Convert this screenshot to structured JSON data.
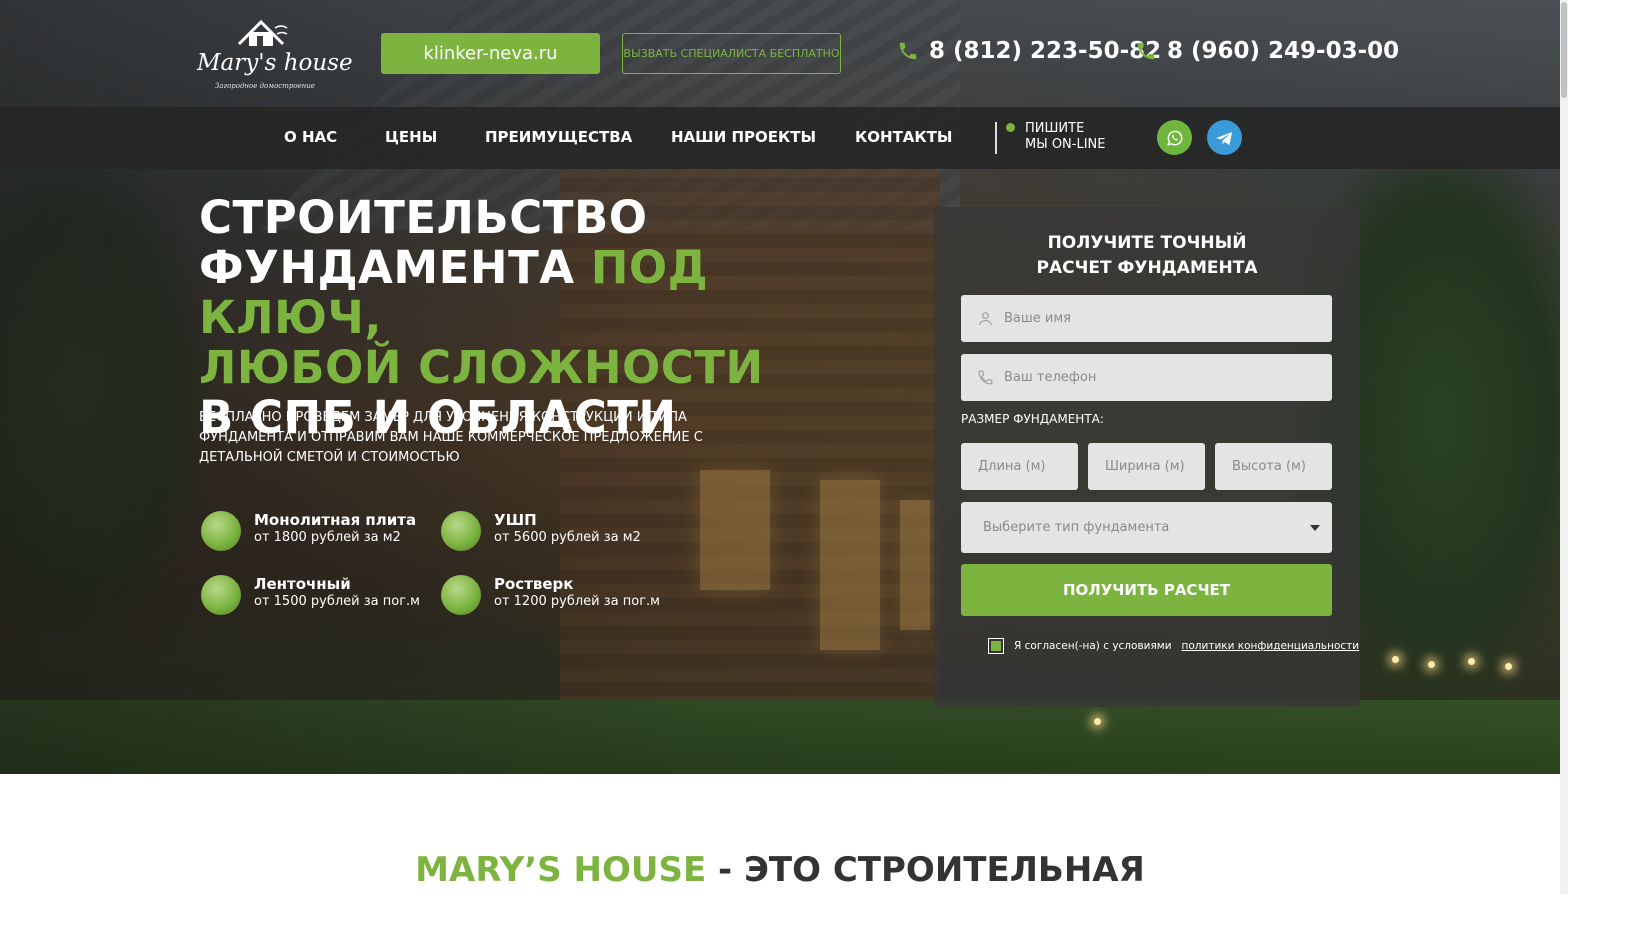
{
  "header": {
    "logo": {
      "name": "Mary's house",
      "tagline": "Загородное домостроение"
    },
    "site_button": "klinker-neva.ru",
    "call_button": "ВЫЗВАТЬ СПЕЦИАЛИСТА БЕСПЛАТНО",
    "phones": [
      "8 (812) 223-50-82",
      "8 (960) 249-03-00"
    ]
  },
  "nav": {
    "items": [
      "О НАС",
      "ЦЕНЫ",
      "ПРЕИМУЩЕСТВА",
      "НАШИ ПРОЕКТЫ",
      "КОНТАКТЫ"
    ],
    "online_line1": "ПИШИТЕ",
    "online_line2": "МЫ ON-LINE",
    "social": [
      "whatsapp-icon",
      "telegram-icon"
    ]
  },
  "hero": {
    "title_white_1": "СТРОИТЕЛЬСТВО",
    "title_white_2": "ФУНДАМЕНТА",
    "title_green_1": "ПОД КЛЮЧ,",
    "title_green_2": "ЛЮБОЙ СЛОЖНОСТИ",
    "title_white_3": "В СПБ И ОБЛАСТИ",
    "subtitle": "БЕСПЛАТНО ПРОВЕДЕМ ЗАМЕР ДЛЯ УТОЧНЕНИЯ КОНСТРУКЦИИ И ТИПА ФУНДАМЕНТА И ОТПРАВИМ ВАМ НАШЕ КОММЕРЧЕСКОЕ ПРЕДЛОЖЕНИЕ С ДЕТАЛЬНОЙ СМЕТОЙ И СТОИМОСТЬЮ",
    "features": [
      {
        "title": "Монолитная плита",
        "desc": "от 1800 рублей за м2"
      },
      {
        "title": "УШП",
        "desc": "от 5600 рублей за м2"
      },
      {
        "title": "Ленточный",
        "desc": "от 1500 рублей за пог.м"
      },
      {
        "title": "Ростверк",
        "desc": "от 1200 рублей за пог.м"
      }
    ]
  },
  "form": {
    "title_line1": "ПОЛУЧИТЕ ТОЧНЫЙ",
    "title_line2": "РАСЧЕТ ФУНДАМЕНТА",
    "name_placeholder": "Ваше имя",
    "phone_placeholder": "Ваш телефон",
    "size_label": "РАЗМЕР ФУНДАМЕНТА:",
    "length_placeholder": "Длина (м)",
    "width_placeholder": "Ширина (м)",
    "height_placeholder": "Высота (м)",
    "type_select": "Выберите тип фундамента",
    "submit": "ПОЛУЧИТЬ РАСЧЕТ",
    "agree_text": "Я согласен(-на) с условиями",
    "agree_link": "политики конфиденциальности",
    "agree_checked": true
  },
  "section": {
    "green": "MARY’S HOUSE",
    "dark": " - ЭТО СТРОИТЕЛЬНАЯ"
  },
  "colors": {
    "accent": "#7db440",
    "nav_bg": "#262626",
    "form_bg": "#373737"
  }
}
